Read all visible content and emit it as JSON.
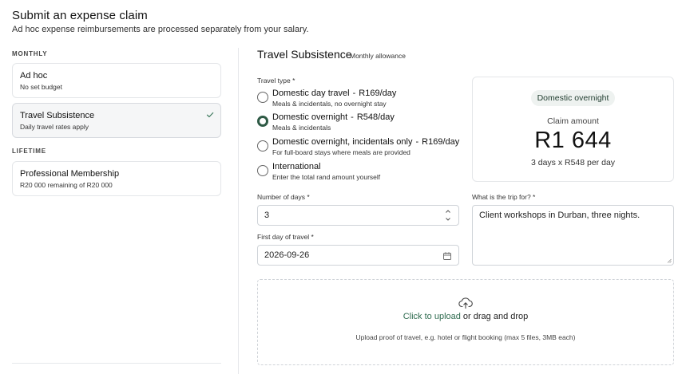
{
  "header": {
    "title": "Submit an expense claim",
    "subtitle": "Ad hoc expense reimbursements are processed separately from your salary."
  },
  "sections": {
    "monthly_label": "MONTHLY",
    "lifetime_label": "LIFETIME"
  },
  "claim_types": [
    {
      "title": "Ad hoc",
      "desc": "No set budget",
      "selected": false
    },
    {
      "title": "Travel Subsistence",
      "desc": "Daily travel rates apply",
      "selected": true
    },
    {
      "title": "Professional Membership",
      "desc": "R20 000 remaining of R20 000",
      "selected": false
    }
  ],
  "panel": {
    "title": "Travel Subsistence",
    "badge": "Monthly allowance"
  },
  "travel_type": {
    "label": "Travel type *",
    "options": [
      {
        "title": "Domestic day travel",
        "rate": "R169/day",
        "desc": "Meals & incidentals, no overnight stay",
        "checked": false
      },
      {
        "title": "Domestic overnight",
        "rate": "R548/day",
        "desc": "Meals & incidentals",
        "checked": true
      },
      {
        "title": "Domestic overnight, incidentals only",
        "rate": "R169/day",
        "desc": "For full-board stays where meals are provided",
        "checked": false
      },
      {
        "title": "International",
        "rate": "",
        "desc": "Enter the total rand amount yourself",
        "checked": false
      }
    ],
    "separator": "-"
  },
  "summary": {
    "pill": "Domestic overnight",
    "claim_label": "Claim amount",
    "amount": "R1 644",
    "breakdown": "3 days x R548 per day"
  },
  "days": {
    "label": "Number of days *",
    "value": "3"
  },
  "first_day": {
    "label": "First day of travel *",
    "value": "2026-09-26"
  },
  "purpose": {
    "label": "What is the trip for? *",
    "value": "Client workshops in Durban, three nights."
  },
  "upload": {
    "link_text": "Click to upload",
    "rest_text": " or drag and drop",
    "hint": "Upload proof of travel, e.g. hotel or flight booking (max 5 files, 3MB each)"
  },
  "colors": {
    "accent": "#2e5a45",
    "link": "#2e6b4f",
    "pill_bg": "#eef2f0"
  }
}
